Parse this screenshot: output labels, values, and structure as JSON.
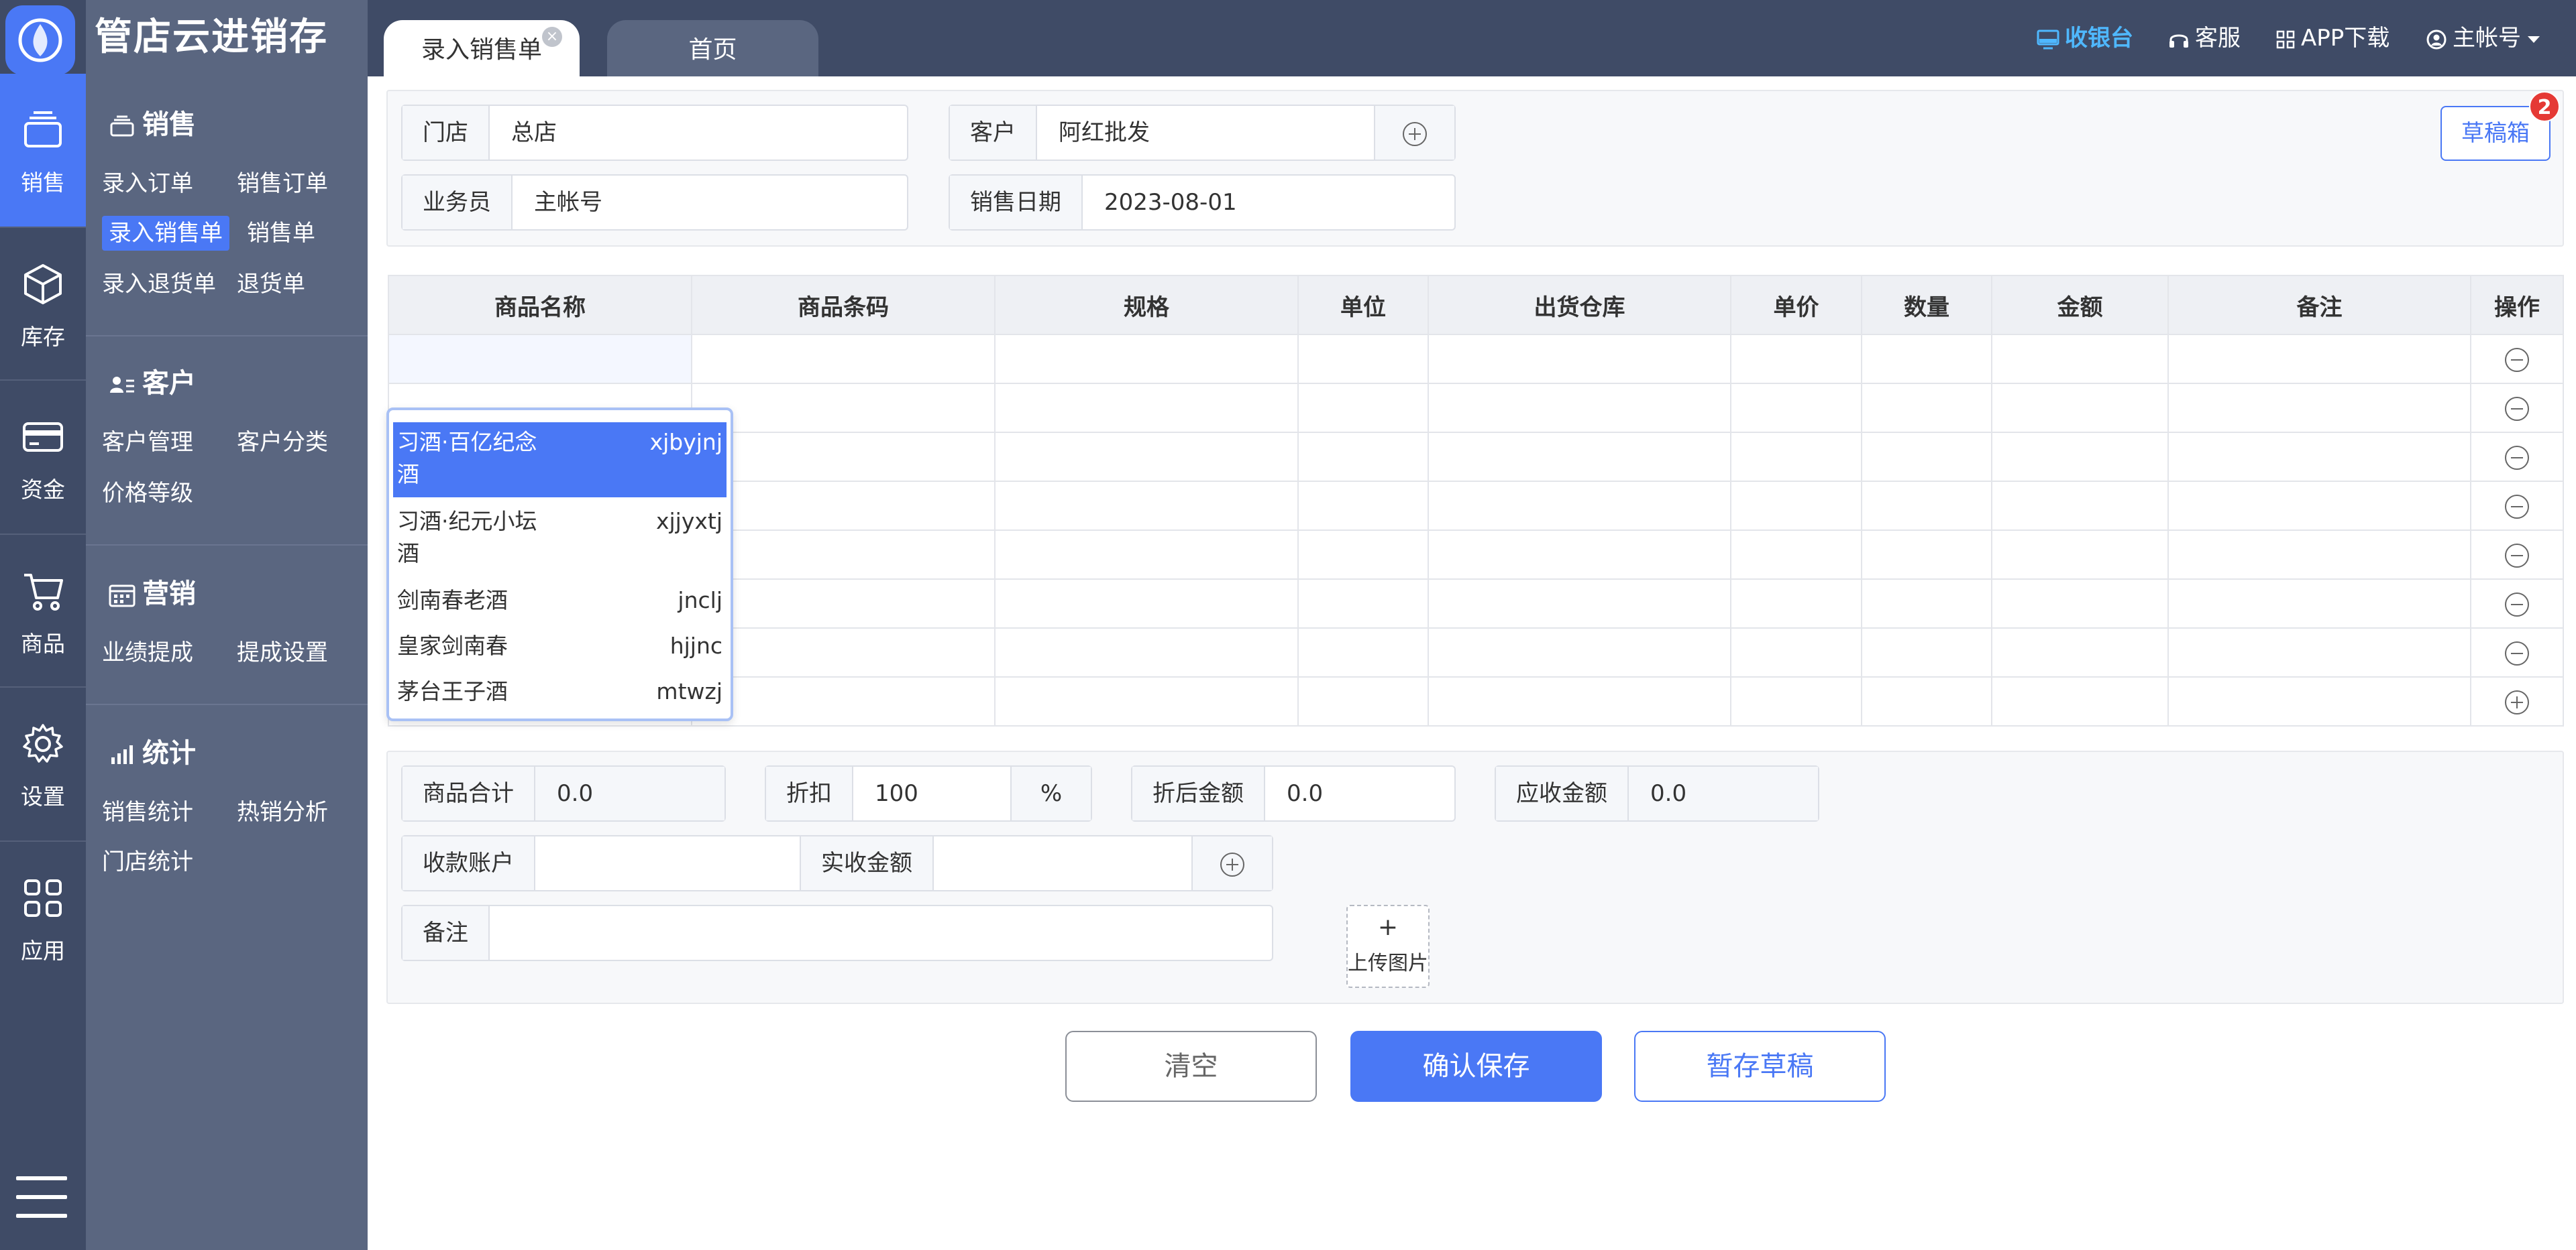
{
  "app": {
    "name": "管店云进销存"
  },
  "rail": [
    {
      "label": "销售",
      "icon": "sales-box-icon",
      "active": true
    },
    {
      "label": "库存",
      "icon": "cube-icon"
    },
    {
      "label": "资金",
      "icon": "card-icon"
    },
    {
      "label": "商品",
      "icon": "cart-icon"
    },
    {
      "label": "设置",
      "icon": "gear-icon"
    },
    {
      "label": "应用",
      "icon": "grid-icon"
    }
  ],
  "sidebar": {
    "sales": {
      "title": "销售",
      "items": [
        "录入订单",
        "销售订单",
        "录入销售单",
        "销售单",
        "录入退货单",
        "退货单"
      ]
    },
    "customer": {
      "title": "客户",
      "items": [
        "客户管理",
        "客户分类",
        "价格等级"
      ]
    },
    "marketing": {
      "title": "营销",
      "items": [
        "业绩提成",
        "提成设置"
      ]
    },
    "stats": {
      "title": "统计",
      "items": [
        "销售统计",
        "热销分析",
        "门店统计"
      ]
    }
  },
  "tabs": {
    "active": "录入销售单",
    "home": "首页",
    "close": "×"
  },
  "topbar": {
    "cashier": "收银台",
    "service": "客服",
    "app": "APP下载",
    "account": "主帐号"
  },
  "form": {
    "store_label": "门店",
    "store_value": "总店",
    "customer_label": "客户",
    "customer_value": "阿红批发",
    "salesman_label": "业务员",
    "salesman_value": "主帐号",
    "date_label": "销售日期",
    "date_value": "2023-08-01",
    "draft_box": "草稿箱",
    "draft_count": "2"
  },
  "table": {
    "headers": [
      "商品名称",
      "商品条码",
      "规格",
      "单位",
      "出货仓库",
      "单价",
      "数量",
      "金额",
      "备注",
      "操作"
    ]
  },
  "dropdown": [
    {
      "name": "习酒·百亿纪念酒",
      "code": "xjbyjnj",
      "highlight": true
    },
    {
      "name": "习酒·纪元小坛酒",
      "code": "xjjyxtj"
    },
    {
      "name": "剑南春老酒",
      "code": "jnclj"
    },
    {
      "name": "皇家剑南春",
      "code": "hjjnc"
    },
    {
      "name": "茅台王子酒",
      "code": "mtwzj"
    }
  ],
  "summary": {
    "total_label": "商品合计",
    "total_value": "0.0",
    "discount_label": "折扣",
    "discount_value": "100",
    "discount_unit": "%",
    "after_label": "折后金额",
    "after_value": "0.0",
    "receivable_label": "应收金额",
    "receivable_value": "0.0",
    "account_label": "收款账户",
    "account_value": "",
    "paid_label": "实收金额",
    "paid_value": "",
    "remark_label": "备注",
    "remark_value": "",
    "upload_plus": "+",
    "upload_label": "上传图片"
  },
  "buttons": {
    "clear": "清空",
    "save": "确认保存",
    "draft": "暂存草稿"
  },
  "colors": {
    "primary": "#4a78f5",
    "rail": "#3f4b66",
    "sidebar": "#5a6680",
    "badge": "#e53935",
    "cashier": "#4fb8ff"
  }
}
